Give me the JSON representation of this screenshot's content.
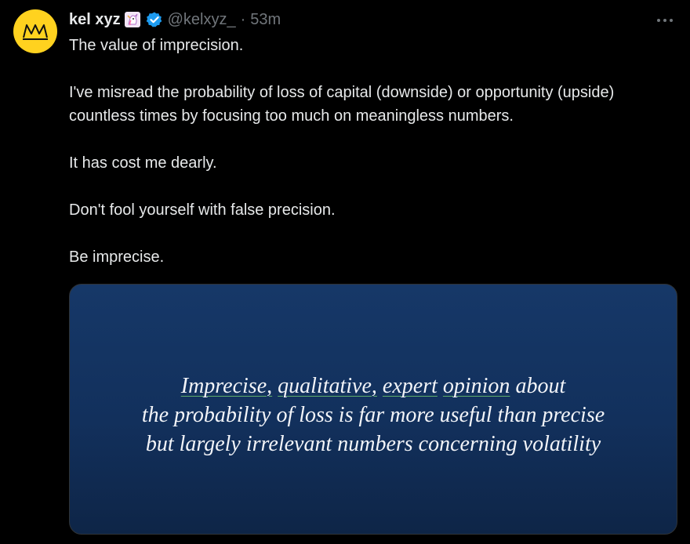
{
  "author": {
    "display_name": "kel xyz",
    "handle": "@kelxyz_",
    "separator": "·",
    "timestamp": "53m",
    "avatar_color": "#ffd21f"
  },
  "icons": {
    "avatar": "crown-logo",
    "badge": "unicorn-emoji-icon",
    "verified": "verified-check-icon",
    "more": "more-options-icon"
  },
  "post": {
    "paragraphs": [
      "The value of imprecision.",
      "I've misread the probability of loss of capital (downside) or opportunity (upside) countless times by focusing too much on meaningless numbers.",
      "It has cost me dearly.",
      "Don't fool yourself with false precision.",
      "Be imprecise."
    ]
  },
  "media": {
    "slide_line1_words": [
      "Imprecise,",
      "qualitative,",
      "expert",
      "opinion",
      "about"
    ],
    "slide_line2": "the probability of loss is far more useful than precise",
    "slide_line3": "but largely irrelevant numbers concerning volatility",
    "background_color": "#163868",
    "underline_color": "#5fae6b"
  },
  "colors": {
    "background": "#000000",
    "text_primary": "#e7e9ea",
    "text_secondary": "#71767b",
    "verified_blue": "#1d9bf0"
  }
}
